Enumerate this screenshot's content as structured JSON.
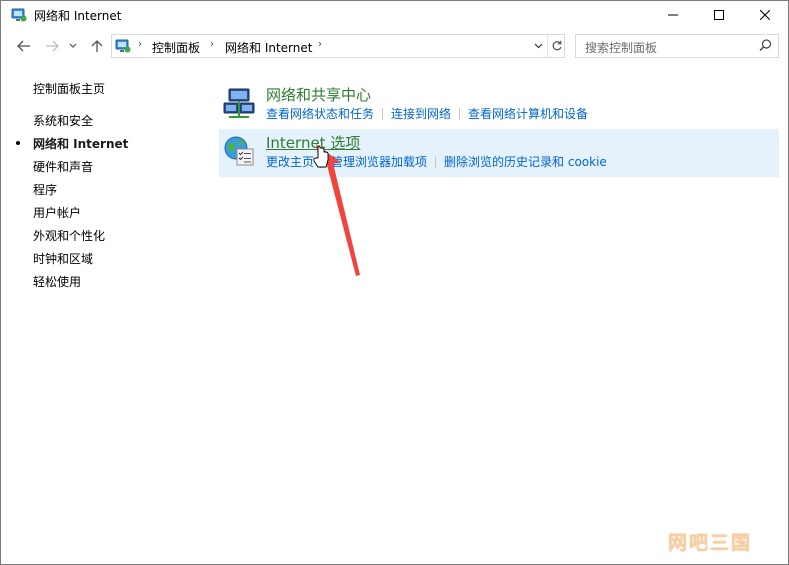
{
  "window": {
    "title": "网络和 Internet"
  },
  "navigation": {
    "breadcrumbs": [
      "控制面板",
      "网络和 Internet"
    ],
    "search_placeholder": "搜索控制面板"
  },
  "sidebar": {
    "home": "控制面板主页",
    "items": [
      {
        "label": "系统和安全",
        "active": false
      },
      {
        "label": "网络和 Internet",
        "active": true
      },
      {
        "label": "硬件和声音",
        "active": false
      },
      {
        "label": "程序",
        "active": false
      },
      {
        "label": "用户帐户",
        "active": false
      },
      {
        "label": "外观和个性化",
        "active": false
      },
      {
        "label": "时钟和区域",
        "active": false
      },
      {
        "label": "轻松使用",
        "active": false
      }
    ]
  },
  "main": {
    "sections": [
      {
        "title": "网络和共享中心",
        "icon": "network-sharing-center-icon",
        "links": [
          "查看网络状态和任务",
          "连接到网络",
          "查看网络计算机和设备"
        ]
      },
      {
        "title": "Internet 选项",
        "icon": "internet-options-icon",
        "highlighted": true,
        "links": [
          "更改主页",
          "管理浏览器加载项",
          "删除浏览的历史记录和 cookie"
        ]
      }
    ]
  },
  "annotation": {
    "arrow_color": "#f2433e"
  },
  "watermark": "网吧三国",
  "colors": {
    "link": "#0066cc",
    "section_title": "#2e7d32",
    "highlight": "#e5f1fb"
  }
}
